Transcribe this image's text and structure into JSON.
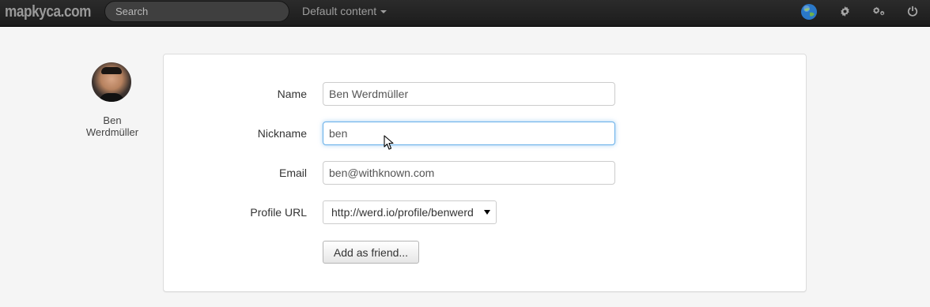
{
  "header": {
    "brand": "mapkyca.com",
    "search_placeholder": "Search",
    "content_menu_label": "Default content",
    "icons": [
      "globe-icon",
      "gear-icon",
      "gears-icon",
      "power-icon"
    ]
  },
  "profile": {
    "name": "Ben Werdmüller"
  },
  "form": {
    "name_label": "Name",
    "name_value": "Ben Werdmüller",
    "nickname_label": "Nickname",
    "nickname_value": "ben",
    "email_label": "Email",
    "email_value": "ben@withknown.com",
    "profile_url_label": "Profile URL",
    "profile_url_value": "http://werd.io/profile/benwerd",
    "add_friend_label": "Add as friend..."
  }
}
